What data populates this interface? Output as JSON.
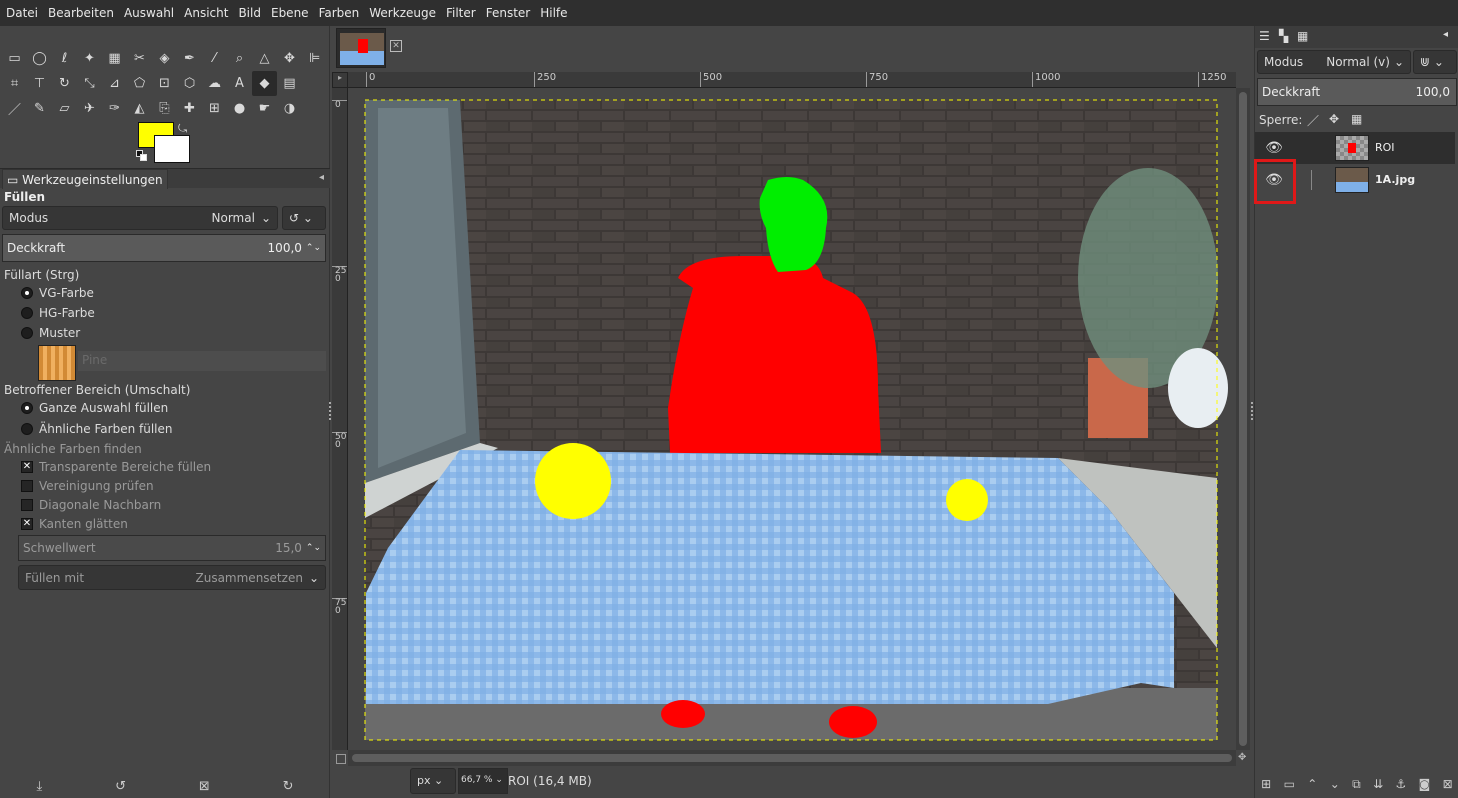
{
  "menu": [
    "Datei",
    "Bearbeiten",
    "Auswahl",
    "Ansicht",
    "Bild",
    "Ebene",
    "Farben",
    "Werkzeuge",
    "Filter",
    "Fenster",
    "Hilfe"
  ],
  "colors": {
    "foreground": "#ffff00",
    "background": "#ffffff",
    "roi_person": "#ff0000",
    "roi_head": "#00ee00",
    "roi_balls": "#ffff00"
  },
  "tool_options": {
    "tab_label": "Werkzeugeinstellungen",
    "tool_name": "Füllen",
    "mode_label": "Modus",
    "mode_value": "Normal",
    "opacity_label": "Deckkraft",
    "opacity_value": "100,0",
    "fill_type_label": "Füllart  (Strg)",
    "fill_types": [
      "VG-Farbe",
      "HG-Farbe",
      "Muster"
    ],
    "pattern_name": "Pine",
    "area_label": "Betroffener Bereich (Umschalt)",
    "areas": [
      "Ganze Auswahl füllen",
      "Ähnliche Farben füllen"
    ],
    "similar_label": "Ähnliche Farben finden",
    "checks": [
      "Transparente Bereiche füllen",
      "Vereinigung prüfen",
      "Diagonale Nachbarn",
      "Kanten glätten"
    ],
    "threshold_label": "Schwellwert",
    "threshold_value": "15,0",
    "fill_with_label": "Füllen mit",
    "fill_with_value": "Zusammensetzen"
  },
  "ruler": {
    "h_ticks": [
      "0",
      "250",
      "500",
      "750",
      "1000",
      "1250"
    ],
    "v_ticks": [
      "0",
      "250",
      "500",
      "750"
    ]
  },
  "status": {
    "unit": "px",
    "zoom": "66,7 %",
    "text": "ROI (16,4 MB)"
  },
  "layers": {
    "mode_label": "Modus",
    "mode_value": "Normal (v)",
    "opacity_label": "Deckkraft",
    "opacity_value": "100,0",
    "lock_label": "Sperre:",
    "items": [
      {
        "name": "ROI"
      },
      {
        "name": "1A.jpg"
      }
    ]
  }
}
